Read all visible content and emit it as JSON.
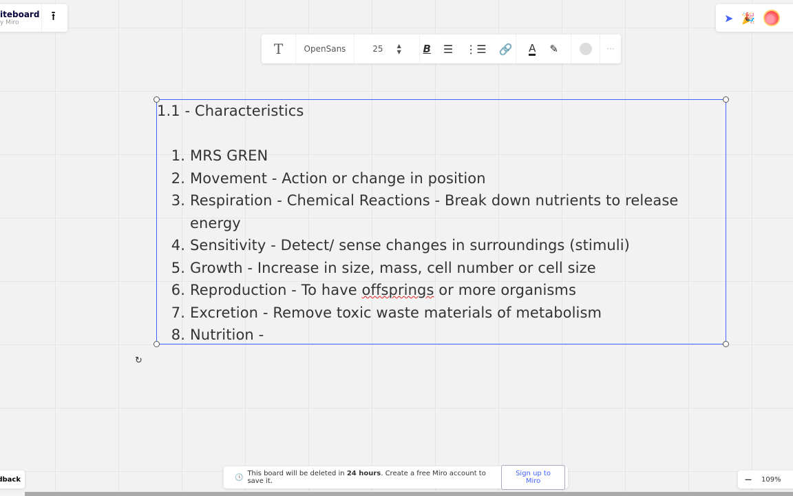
{
  "board": {
    "title": "iteboard",
    "subtitle": "y Miro",
    "export_icon": "upload-icon"
  },
  "toolbar": {
    "font": "OpenSans",
    "size": "25",
    "icons": [
      "text-icon",
      "bold-icon",
      "align-left-icon",
      "bullet-list-icon",
      "link-icon",
      "text-color-icon",
      "highlighter-icon",
      "fill-color-icon",
      "more-icon"
    ]
  },
  "textbox": {
    "heading": "1.1 - Characteristics",
    "items": [
      {
        "n": "1.",
        "t": "MRS GREN"
      },
      {
        "n": "2.",
        "t": "Movement - Action or change in position"
      },
      {
        "n": "3.",
        "t": "Respiration - Chemical Reactions - Break down nutrients to release energy"
      },
      {
        "n": "4.",
        "t": "Sensitivity - Detect/ sense changes in surroundings (stimuli)"
      },
      {
        "n": "5.",
        "t": "Growth - Increase in size, mass, cell number or cell size"
      },
      {
        "n": "6.",
        "t_pre": "Reproduction - To have ",
        "t_spell": "offsprings",
        "t_post": " or more organisms"
      },
      {
        "n": "7.",
        "t": "Excretion - Remove toxic waste materials of metabolism"
      },
      {
        "n": "8.",
        "t": "Nutrition -"
      }
    ]
  },
  "notice": {
    "pre": "This board will be deleted in ",
    "bold": "24 hours",
    "post": ". Create a free Miro account to save it.",
    "button": "Sign up to Miro"
  },
  "feedback": "dback",
  "zoom": {
    "level": "109%"
  },
  "colors": {
    "accent": "#4262ff"
  }
}
